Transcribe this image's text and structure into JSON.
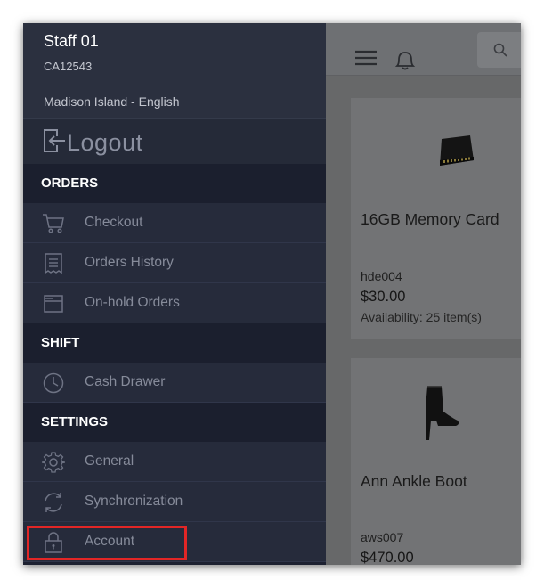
{
  "profile": {
    "staff_name": "Staff 01",
    "staff_code": "CA12543",
    "store": "Madison Island - English"
  },
  "logout": {
    "label": "Logout",
    "icon": "logout-icon"
  },
  "sections": {
    "orders": "ORDERS",
    "shift": "SHIFT",
    "settings": "SETTINGS"
  },
  "menu": {
    "checkout": {
      "label": "Checkout",
      "icon": "cart-icon"
    },
    "orders_history": {
      "label": "Orders History",
      "icon": "receipt-icon"
    },
    "onhold_orders": {
      "label": "On-hold Orders",
      "icon": "folder-icon"
    },
    "cash_drawer": {
      "label": "Cash Drawer",
      "icon": "clock-icon"
    },
    "general": {
      "label": "General",
      "icon": "gear-icon"
    },
    "synchronization": {
      "label": "Synchronization",
      "icon": "sync-icon"
    },
    "account": {
      "label": "Account",
      "icon": "lock-icon"
    }
  },
  "products": [
    {
      "name": "16GB Memory Card",
      "sku": "hde004",
      "price": "$30.00",
      "availability": "Availability: 25 item(s)"
    },
    {
      "name": "Ann Ankle Boot",
      "sku": "aws007",
      "price": "$470.00"
    }
  ],
  "colors": {
    "drawer_bg": "#1d2131",
    "section_bg": "#1b1f2e",
    "item_bg": "#262b3b",
    "highlight_border": "#e22626",
    "overlay": "#6c6d70"
  }
}
